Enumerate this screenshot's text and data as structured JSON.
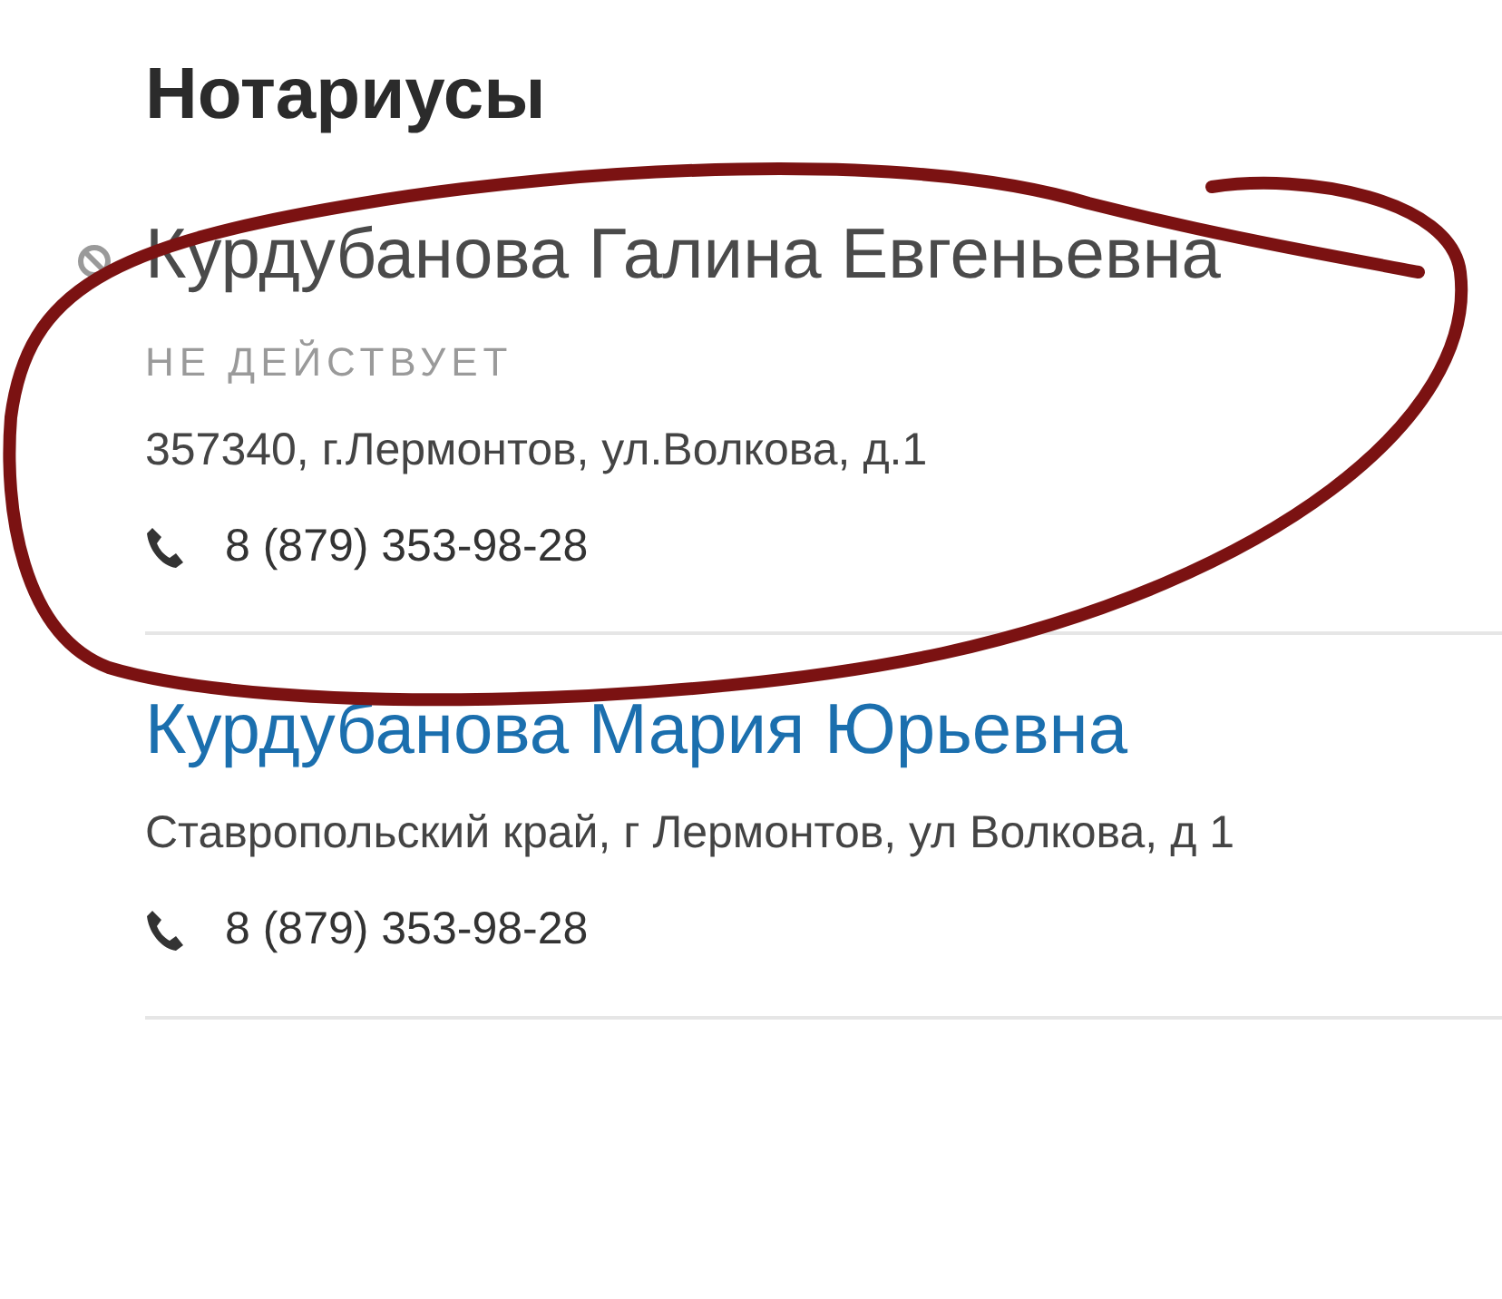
{
  "heading": "Нотариусы",
  "notaries": [
    {
      "name": "Курдубанова Галина Евгеньевна",
      "active": false,
      "status": "НЕ ДЕЙСТВУЕТ",
      "address": "357340, г.Лермонтов, ул.Волкова, д.1",
      "phone": "8 (879) 353-98-28"
    },
    {
      "name": "Курдубанова Мария Юрьевна",
      "active": true,
      "address": "Ставропольский край, г Лермонтов, ул Волкова, д 1",
      "phone": "8 (879) 353-98-28"
    }
  ]
}
